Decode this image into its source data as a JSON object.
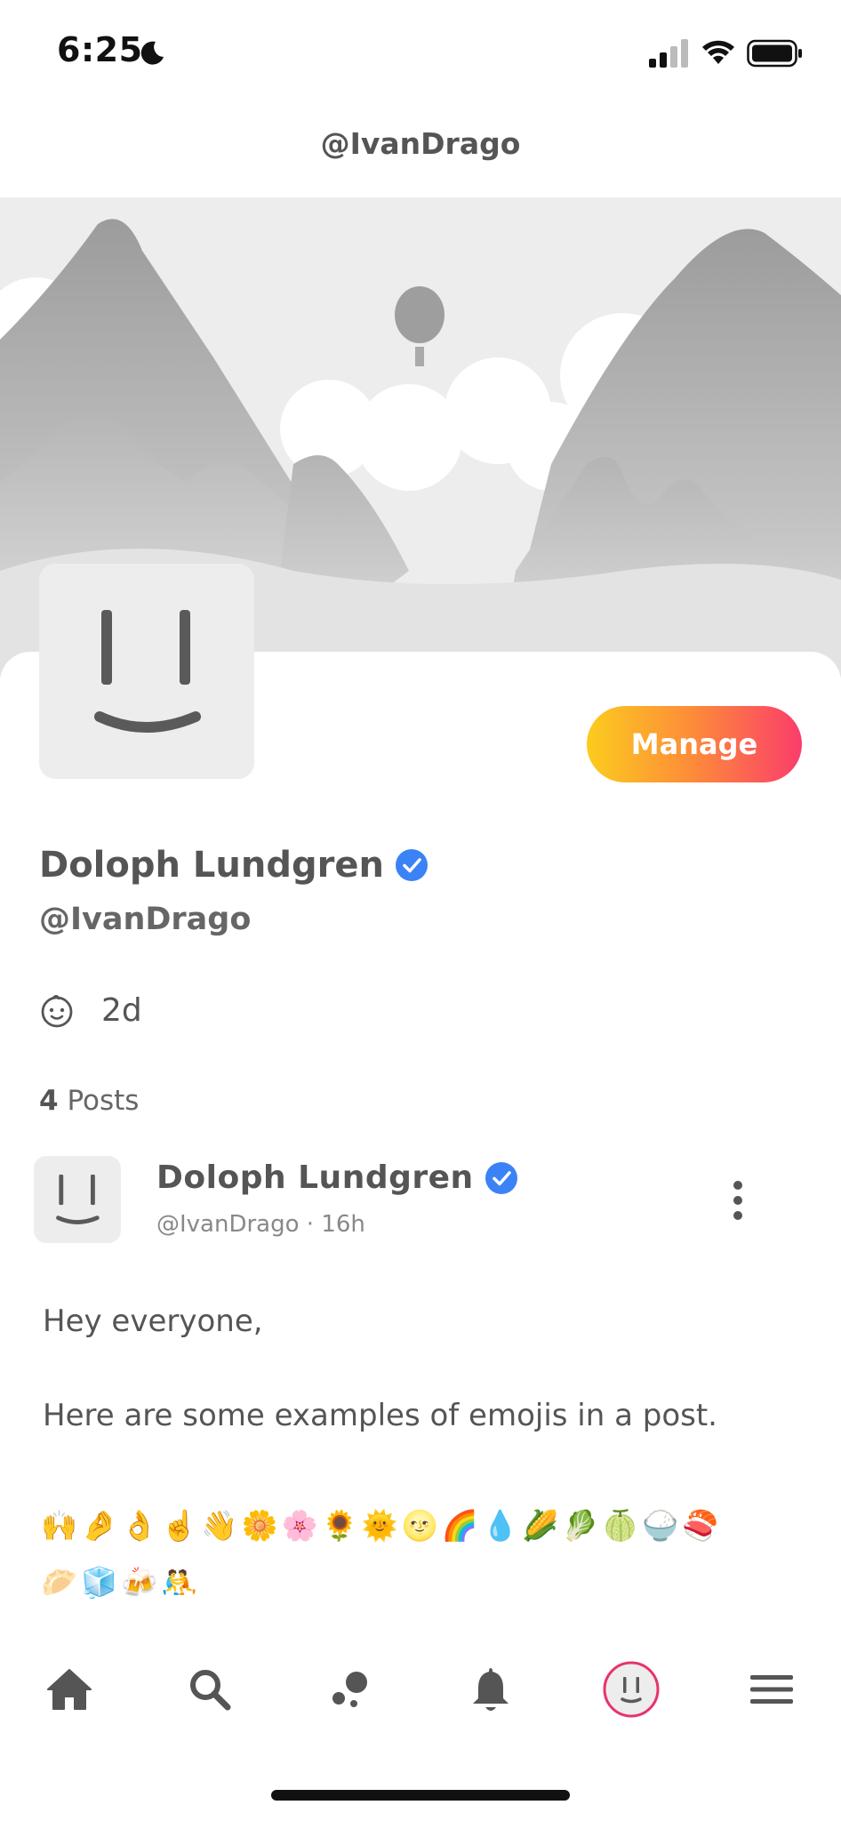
{
  "status_bar": {
    "time": "6:25"
  },
  "header": {
    "title": "@IvanDrago"
  },
  "profile": {
    "name": "Doloph Lundgren",
    "handle": "@IvanDrago",
    "manage_label": "Manage",
    "age": "2d",
    "posts_count": "4",
    "posts_label": "Posts"
  },
  "post": {
    "author_name": "Doloph Lundgren",
    "meta": "@IvanDrago · 16h",
    "line1": "Hey everyone,",
    "line2": "Here are some examples of emojis in a post.",
    "emojis_row1": "🙌🤌👌☝️👋🌼🌸🌻🌞🌝🌈💧🌽🥬🍈🍚🍣",
    "emojis_row2": "🥟🧊🍻🤼"
  },
  "tabs": [
    "home-icon",
    "search-icon",
    "explore-icon",
    "bell-icon",
    "profile-avatar-icon",
    "menu-icon"
  ],
  "colors": {
    "accent_pink": "#fb3d6c",
    "accent_yellow": "#fccc1e",
    "verified_blue": "#3b82f6"
  }
}
